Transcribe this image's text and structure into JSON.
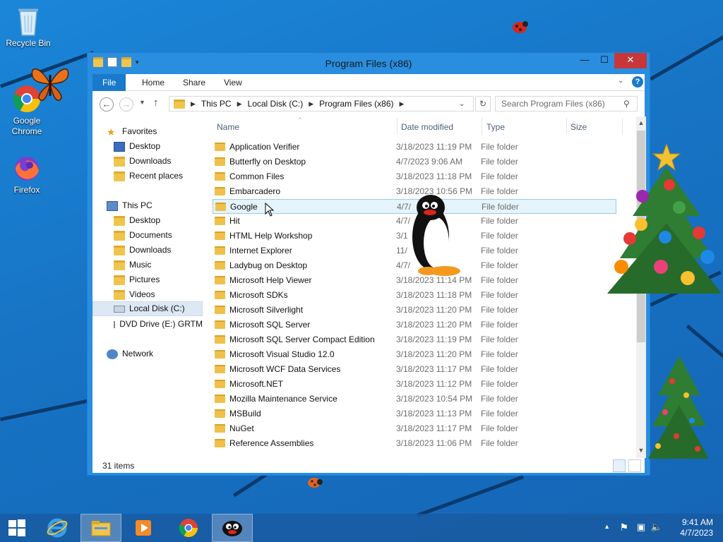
{
  "desktop": {
    "icons": [
      {
        "label": "Recycle Bin"
      },
      {
        "label": "Google\nChrome"
      },
      {
        "label": "Firefox"
      }
    ]
  },
  "window": {
    "title": "Program Files (x86)",
    "ribbon_tabs": [
      "File",
      "Home",
      "Share",
      "View"
    ],
    "address": [
      "This PC",
      "Local Disk (C:)",
      "Program Files (x86)"
    ],
    "search_placeholder": "Search Program Files (x86)",
    "nav": {
      "favorites_label": "Favorites",
      "favorites": [
        "Desktop",
        "Downloads",
        "Recent places"
      ],
      "thispc_label": "This PC",
      "thispc": [
        "Desktop",
        "Documents",
        "Downloads",
        "Music",
        "Pictures",
        "Videos",
        "Local Disk (C:)",
        "DVD Drive (E:) GRTM"
      ],
      "network_label": "Network"
    },
    "columns": {
      "name": "Name",
      "date": "Date modified",
      "type": "Type",
      "size": "Size"
    },
    "files": [
      {
        "name": "Application Verifier",
        "date": "3/18/2023 11:19 PM",
        "type": "File folder"
      },
      {
        "name": "Butterfly on Desktop",
        "date": "4/7/2023 9:06 AM",
        "type": "File folder"
      },
      {
        "name": "Common Files",
        "date": "3/18/2023 11:18 PM",
        "type": "File folder"
      },
      {
        "name": "Embarcadero",
        "date": "3/18/2023 10:56 PM",
        "type": "File folder"
      },
      {
        "name": "Google",
        "date": "4/7/",
        "type": "File folder"
      },
      {
        "name": "Hit",
        "date": "4/7/",
        "type": "File folder"
      },
      {
        "name": "HTML Help Workshop",
        "date": "3/1",
        "type": "File folder"
      },
      {
        "name": "Internet Explorer",
        "date": "11/",
        "type": "File folder"
      },
      {
        "name": "Ladybug on Desktop",
        "date": "4/7/",
        "type": "File folder"
      },
      {
        "name": "Microsoft Help Viewer",
        "date": "3/18/2023 11:14 PM",
        "type": "File folder"
      },
      {
        "name": "Microsoft SDKs",
        "date": "3/18/2023 11:18 PM",
        "type": "File folder"
      },
      {
        "name": "Microsoft Silverlight",
        "date": "3/18/2023 11:20 PM",
        "type": "File folder"
      },
      {
        "name": "Microsoft SQL Server",
        "date": "3/18/2023 11:20 PM",
        "type": "File folder"
      },
      {
        "name": "Microsoft SQL Server Compact Edition",
        "date": "3/18/2023 11:19 PM",
        "type": "File folder"
      },
      {
        "name": "Microsoft Visual Studio 12.0",
        "date": "3/18/2023 11:20 PM",
        "type": "File folder"
      },
      {
        "name": "Microsoft WCF Data Services",
        "date": "3/18/2023 11:17 PM",
        "type": "File folder"
      },
      {
        "name": "Microsoft.NET",
        "date": "3/18/2023 11:12 PM",
        "type": "File folder"
      },
      {
        "name": "Mozilla Maintenance Service",
        "date": "3/18/2023 10:54 PM",
        "type": "File folder"
      },
      {
        "name": "MSBuild",
        "date": "3/18/2023 11:13 PM",
        "type": "File folder"
      },
      {
        "name": "NuGet",
        "date": "3/18/2023 11:17 PM",
        "type": "File folder"
      },
      {
        "name": "Reference Assemblies",
        "date": "3/18/2023 11:06 PM",
        "type": "File folder"
      }
    ],
    "status": "31 items"
  },
  "taskbar": {
    "time": "9:41 AM",
    "date": "4/7/2023"
  }
}
